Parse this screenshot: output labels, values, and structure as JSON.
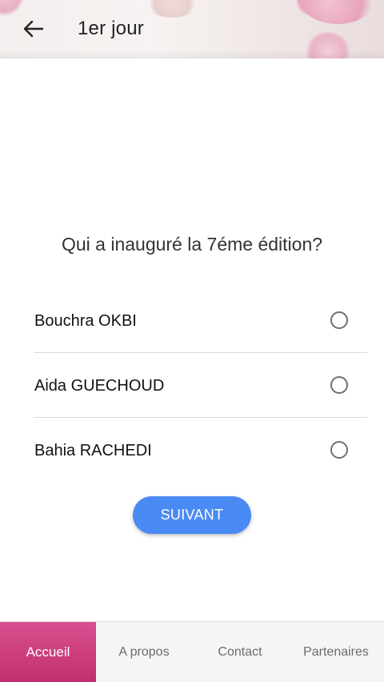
{
  "header": {
    "title": "1er jour",
    "back_icon": "arrow-left-icon"
  },
  "quiz": {
    "question": "Qui a inauguré la 7éme édition?",
    "options": [
      {
        "label": "Bouchra OKBI",
        "selected": false
      },
      {
        "label": "Aida GUECHOUD",
        "selected": false
      },
      {
        "label": "Bahia RACHEDI",
        "selected": false
      }
    ],
    "next_label": "SUIVANT"
  },
  "bottom_nav": {
    "items": [
      {
        "label": "Accueil",
        "active": true
      },
      {
        "label": "A propos",
        "active": false
      },
      {
        "label": "Contact",
        "active": false
      },
      {
        "label": "Partenaires",
        "active": false
      }
    ],
    "active_color": "#c8387a"
  },
  "colors": {
    "accent": "#4a8af4",
    "nav_active": "#c8387a"
  }
}
